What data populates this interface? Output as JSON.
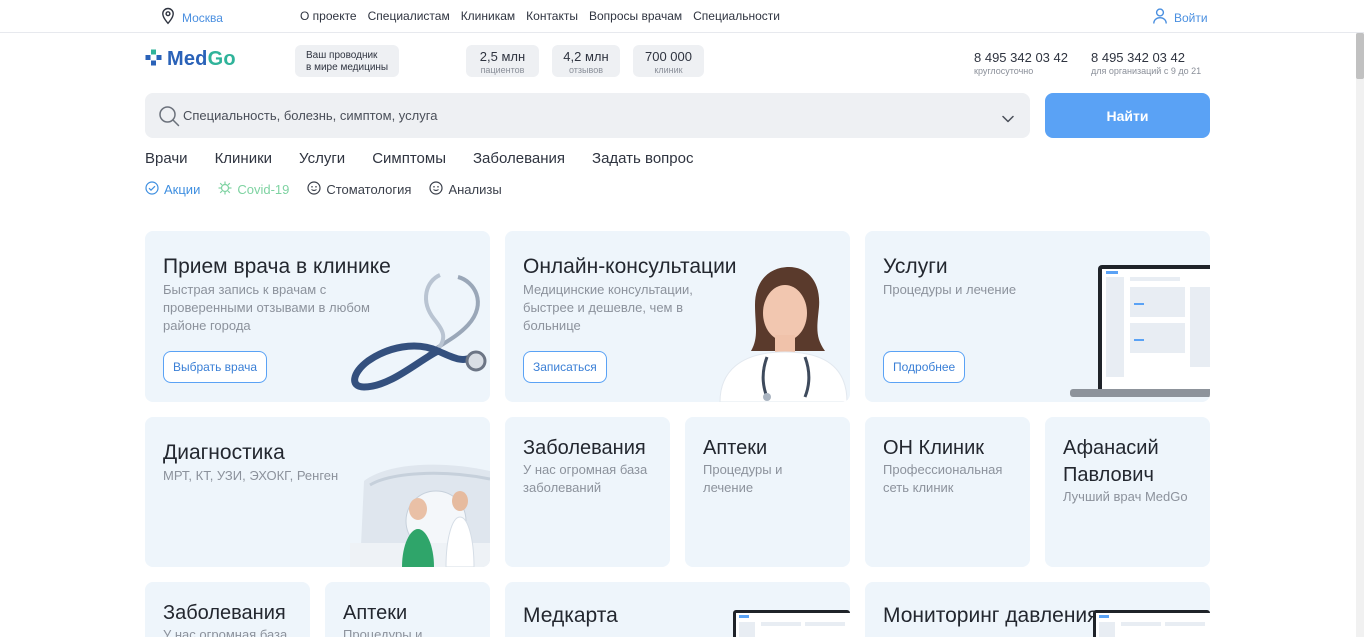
{
  "topbar": {
    "city": "Москва",
    "nav": [
      "О проекте",
      "Специалистам",
      "Клиникам",
      "Контакты",
      "Вопросы врачам",
      "Специальности"
    ],
    "login": "Войти"
  },
  "header": {
    "logo_a": "Med",
    "logo_b": "Go",
    "guide_line1": "Ваш проводник",
    "guide_line2": "в мире медицины",
    "stats": [
      {
        "value": "2,5 млн",
        "label": "пациентов"
      },
      {
        "value": "4,2 млн",
        "label": "отзывов"
      },
      {
        "value": "700 000",
        "label": "клиник"
      }
    ],
    "phones": [
      {
        "number": "8 495 342 03 42",
        "desc": "круглосуточно"
      },
      {
        "number": "8 495 342 03 42",
        "desc": "для организаций с 9 до 21"
      }
    ]
  },
  "search": {
    "placeholder": "Специальность, болезнь, симптом, услуга",
    "button": "Найти"
  },
  "main_nav": [
    "Врачи",
    "Клиники",
    "Услуги",
    "Симптомы",
    "Заболевания",
    "Задать вопрос"
  ],
  "sub_nav": [
    {
      "label": "Акции",
      "color": "#3f8fe0",
      "icon": "check-circle-icon"
    },
    {
      "label": "Covid-19",
      "color": "#7fd3a2",
      "icon": "virus-icon"
    },
    {
      "label": "Стоматология",
      "color": "#3a3f4a",
      "icon": "smiley-icon"
    },
    {
      "label": "Анализы",
      "color": "#3a3f4a",
      "icon": "smiley-icon"
    }
  ],
  "cards": {
    "clinic": {
      "title": "Прием врача в клинике",
      "sub": [
        "Быстрая запись к врачам с",
        "проверенными отзывами в любом",
        "районе города"
      ],
      "button": "Выбрать врача"
    },
    "online": {
      "title": "Онлайн-консультации",
      "sub": [
        "Медицинские консультации,",
        "быстрее и дешевле, чем в",
        "больнице"
      ],
      "button": "Записаться"
    },
    "services": {
      "title": "Услуги",
      "sub": [
        "Процедуры и лечение"
      ],
      "button": "Подробнее"
    },
    "diagnostics": {
      "title": "Диагностика",
      "sub": [
        "МРТ, КТ, УЗИ, ЭХОКГ, Ренген"
      ]
    },
    "diseases": {
      "title": "Заболевания",
      "sub": [
        "У нас огромная база",
        "заболеваний"
      ]
    },
    "pharmacy": {
      "title": "Аптеки",
      "sub": [
        "Процедуры и",
        "лечение"
      ]
    },
    "onclinic": {
      "title": "ОН Клиник",
      "sub": [
        "Профессиональная",
        "сеть клиник"
      ]
    },
    "doctor": {
      "title": [
        "Афанасий",
        "Павлович"
      ],
      "sub": [
        "Лучший врач MedGo"
      ]
    },
    "diseases2": {
      "title": "Заболевания",
      "sub": [
        "У нас огромная база"
      ]
    },
    "pharmacy2": {
      "title": "Аптеки",
      "sub": [
        "Процедуры и"
      ]
    },
    "medcard": {
      "title": "Медкарта"
    },
    "pressure": {
      "title": "Мониторинг давления"
    }
  }
}
